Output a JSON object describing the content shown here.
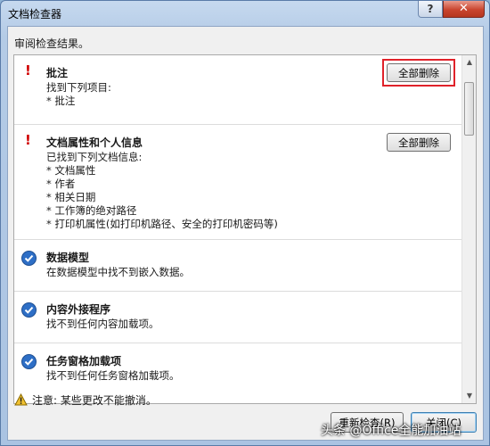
{
  "window": {
    "title": "文档检查器"
  },
  "titlebar": {
    "help_label": "?",
    "close_label": "✕"
  },
  "dialog": {
    "subtitle": "审阅检查结果。"
  },
  "items": [
    {
      "status": "warning",
      "title": "批注",
      "desc": [
        "找到下列项目:",
        "* 批注"
      ],
      "button": "全部删除"
    },
    {
      "status": "warning",
      "title": "文档属性和个人信息",
      "desc": [
        "已找到下列文档信息:",
        "* 文档属性",
        "* 作者",
        "* 相关日期",
        "* 工作簿的绝对路径",
        "* 打印机属性(如打印机路径、安全的打印机密码等)"
      ],
      "button": "全部删除"
    },
    {
      "status": "ok",
      "title": "数据模型",
      "desc": [
        "在数据模型中找不到嵌入数据。"
      ]
    },
    {
      "status": "ok",
      "title": "内容外接程序",
      "desc": [
        "找不到任何内容加载项。"
      ]
    },
    {
      "status": "ok",
      "title": "任务窗格加载项",
      "desc": [
        "找不到任何任务窗格加载项。"
      ]
    }
  ],
  "footer": {
    "note": "注意: 某些更改不能撤消。",
    "reinspect_label": "重新检查(R)",
    "close_label": "关闭(C)"
  },
  "watermark": "头条 @Office全能加油站",
  "colors": {
    "highlight": "#e0222a",
    "warning": "#d00000",
    "check": "#2e6fc6"
  }
}
